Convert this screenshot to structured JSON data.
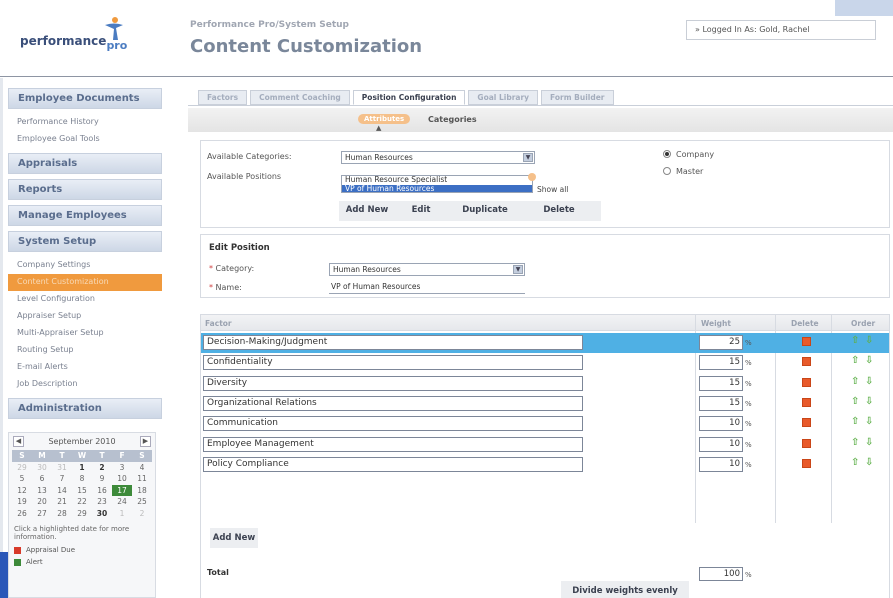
{
  "header": {
    "logo_text": "performance",
    "logo_sub": "pro",
    "breadcrumb": "Performance Pro/System Setup",
    "title": "Content Customization",
    "login_text": "» Logged In As: Gold, Rachel"
  },
  "sidebar": {
    "sections": [
      {
        "label": "Employee Documents",
        "items": [
          "Performance History",
          "Employee Goal Tools"
        ]
      },
      {
        "label": "Appraisals",
        "items": []
      },
      {
        "label": "Reports",
        "items": []
      },
      {
        "label": "Manage Employees",
        "items": []
      },
      {
        "label": "System Setup",
        "items": [
          "Company Settings",
          "Content Customization",
          "Level Configuration",
          "Appraiser Setup",
          "Multi-Appraiser Setup",
          "Routing Setup",
          "E-mail Alerts",
          "Job Description"
        ]
      },
      {
        "label": "Administration",
        "items": []
      }
    ],
    "active_item": "Content Customization"
  },
  "calendar": {
    "prev": "◀",
    "next": "▶",
    "month_label": "September 2010",
    "weekdays": [
      "S",
      "M",
      "T",
      "W",
      "T",
      "F",
      "S"
    ],
    "days": [
      "29",
      "30",
      "31",
      "1",
      "2",
      "3",
      "4",
      "5",
      "6",
      "7",
      "8",
      "9",
      "10",
      "11",
      "12",
      "13",
      "14",
      "15",
      "16",
      "17",
      "18",
      "19",
      "20",
      "21",
      "22",
      "23",
      "24",
      "25",
      "26",
      "27",
      "28",
      "29",
      "30",
      "1",
      "2"
    ],
    "note": "Click a highlighted date for more information.",
    "legend": [
      {
        "label": "Appraisal Due",
        "color": "#d83a2a"
      },
      {
        "label": "Alert",
        "color": "#3d8a3a"
      }
    ]
  },
  "tabs": [
    "Factors",
    "Comment Coaching",
    "Position Configuration",
    "Goal Library",
    "Form Builder"
  ],
  "active_tab": "Position Configuration",
  "subtabs": {
    "attributes": "Attributes",
    "categories": "Categories",
    "arrow": "▲"
  },
  "filters": {
    "available_categories_label": "Available Categories:",
    "available_categories_value": "Human Resources",
    "available_positions_label": "Available Positions",
    "positions": [
      "Human Resource Specialist",
      "VP of Human Resources"
    ],
    "selected_position": "VP of Human Resources",
    "show_all": "Show all",
    "radio_company": "Company",
    "radio_master": "Master"
  },
  "actions": {
    "add_new": "Add New",
    "edit": "Edit",
    "duplicate": "Duplicate",
    "delete": "Delete"
  },
  "edit_position": {
    "title": "Edit Position",
    "category_label": "Category:",
    "category_value": "Human Resources",
    "name_label": "Name:",
    "name_value": "VP of Human Resources",
    "required_mark": "*"
  },
  "grid": {
    "headers": {
      "factor": "Factor",
      "weight": "Weight",
      "delete": "Delete",
      "order": "Order"
    },
    "pct": "%",
    "up_arrow": "⇧",
    "down_arrow": "⇩",
    "rows": [
      {
        "factor": "Decision-Making/Judgment",
        "weight": "25"
      },
      {
        "factor": "Confidentiality",
        "weight": "15"
      },
      {
        "factor": "Diversity",
        "weight": "15"
      },
      {
        "factor": "Organizational Relations",
        "weight": "15"
      },
      {
        "factor": "Communication",
        "weight": "10"
      },
      {
        "factor": "Employee Management",
        "weight": "10"
      },
      {
        "factor": "Policy Compliance",
        "weight": "10"
      }
    ],
    "total_label": "Total",
    "total_value": "100",
    "divide_button": "Divide weights evenly",
    "add_new": "Add New"
  },
  "colors": {
    "accent_orange": "#f09a3e",
    "selected_row": "#4fb0e4",
    "delete_icon": "#e85a2a",
    "arrow_green": "#5fb04a"
  }
}
